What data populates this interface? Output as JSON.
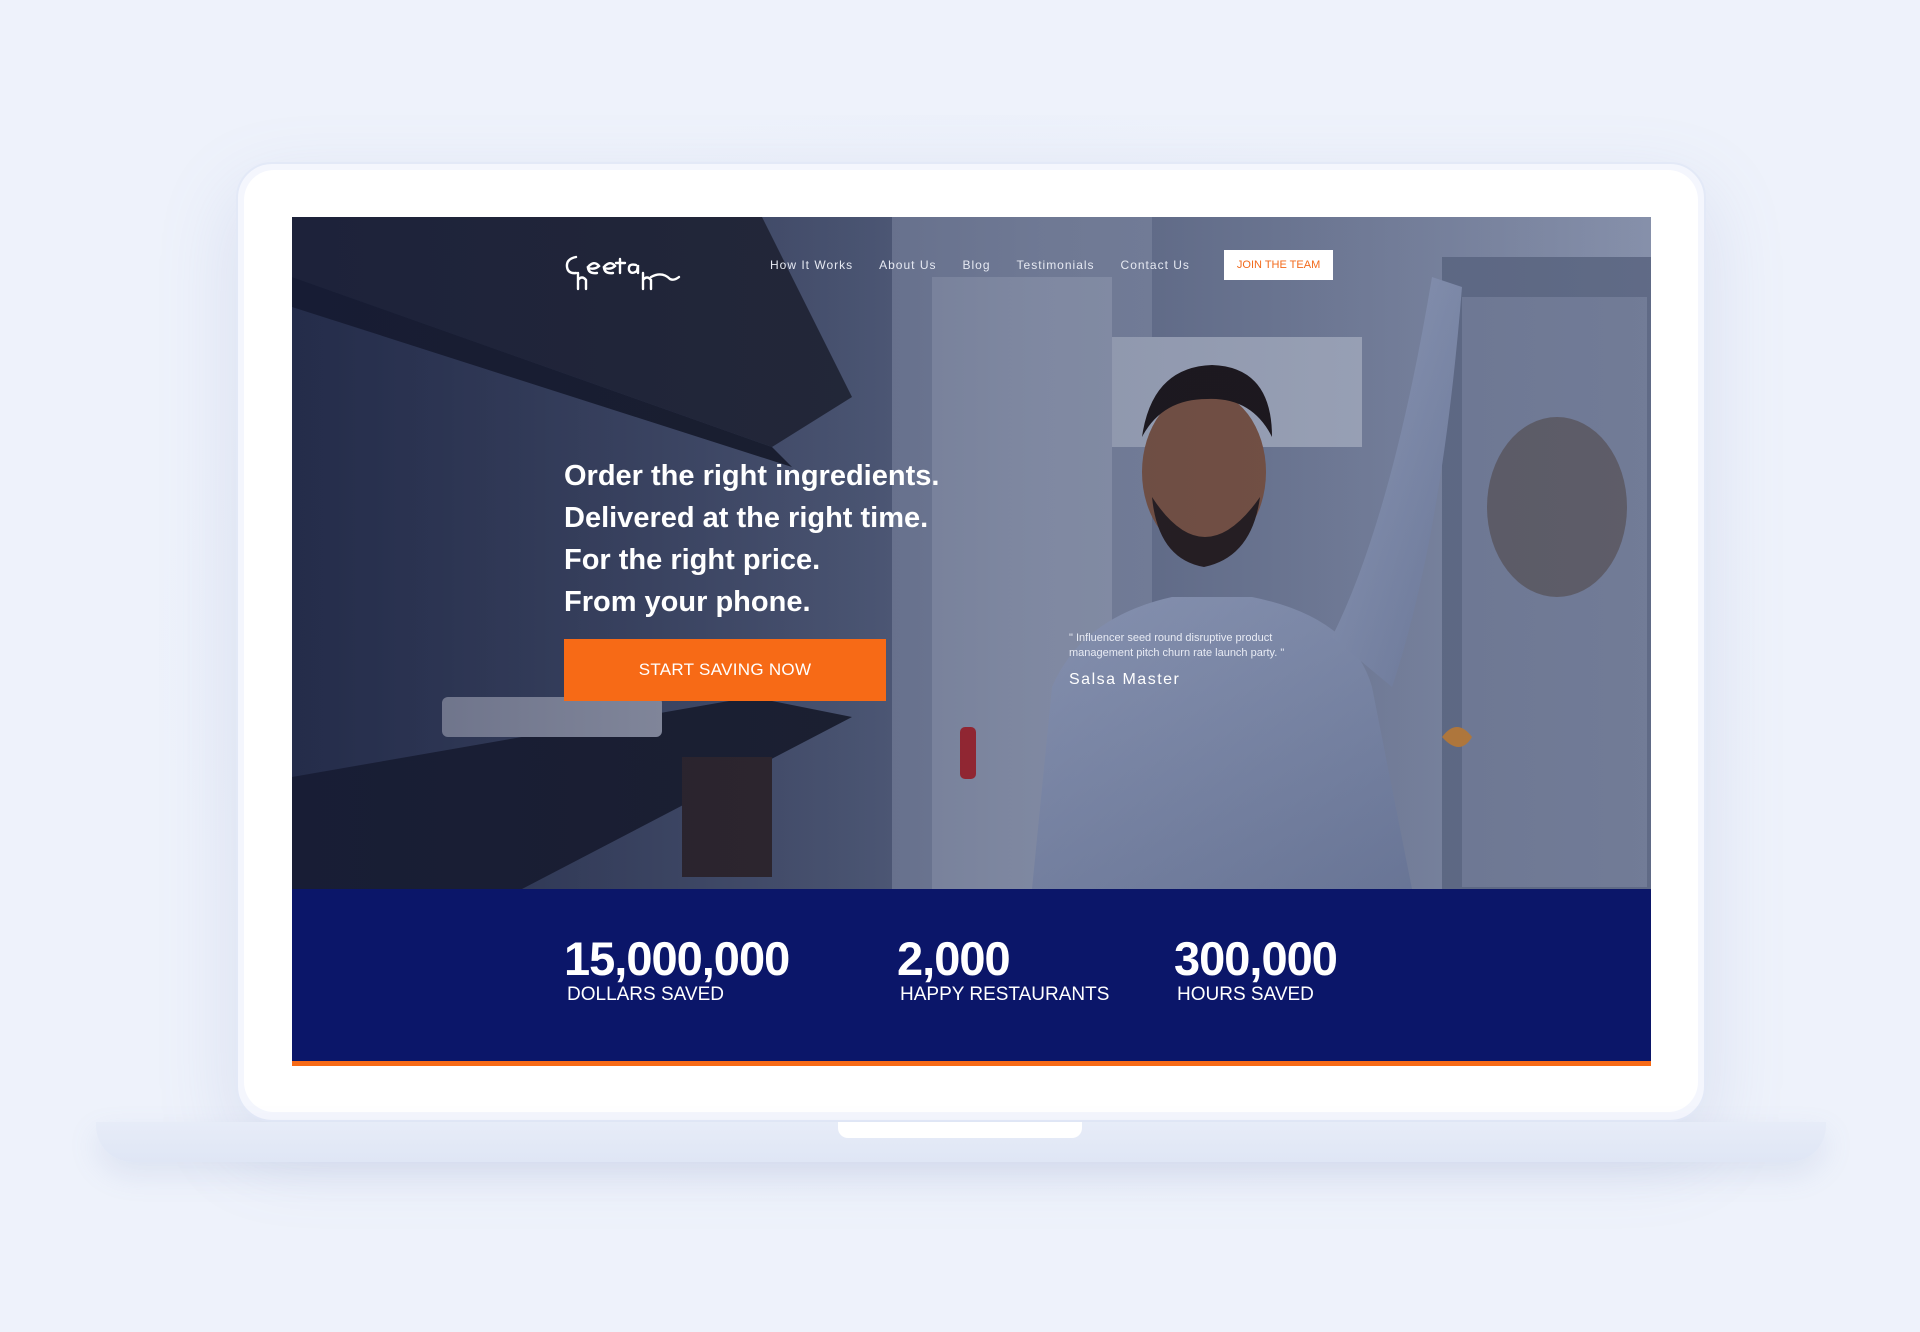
{
  "colors": {
    "page_background": "#eef2fb",
    "brand_orange": "#f76a16",
    "stats_navy": "#0b1669",
    "white": "#ffffff"
  },
  "header": {
    "logo_text": "Cheetah",
    "nav_links": [
      "How It Works",
      "About Us",
      "Blog",
      "Testimonials",
      "Contact Us"
    ],
    "cta_label": "JOIN THE TEAM"
  },
  "hero": {
    "headline_lines": [
      "Order the right ingredients.",
      "Delivered at the right time.",
      "For the right price.",
      "From your phone."
    ],
    "cta_label": "START SAVING NOW",
    "image_icon": "chef-kitchen-photo",
    "testimonial": {
      "quote": "\" Influencer seed round disruptive product management pitch churn rate launch party. \"",
      "author": "Salsa Master"
    }
  },
  "stats": [
    {
      "value": "15,000,000",
      "label": "DOLLARS SAVED"
    },
    {
      "value": "2,000",
      "label": "HAPPY RESTAURANTS"
    },
    {
      "value": "300,000",
      "label": "HOURS SAVED"
    }
  ]
}
